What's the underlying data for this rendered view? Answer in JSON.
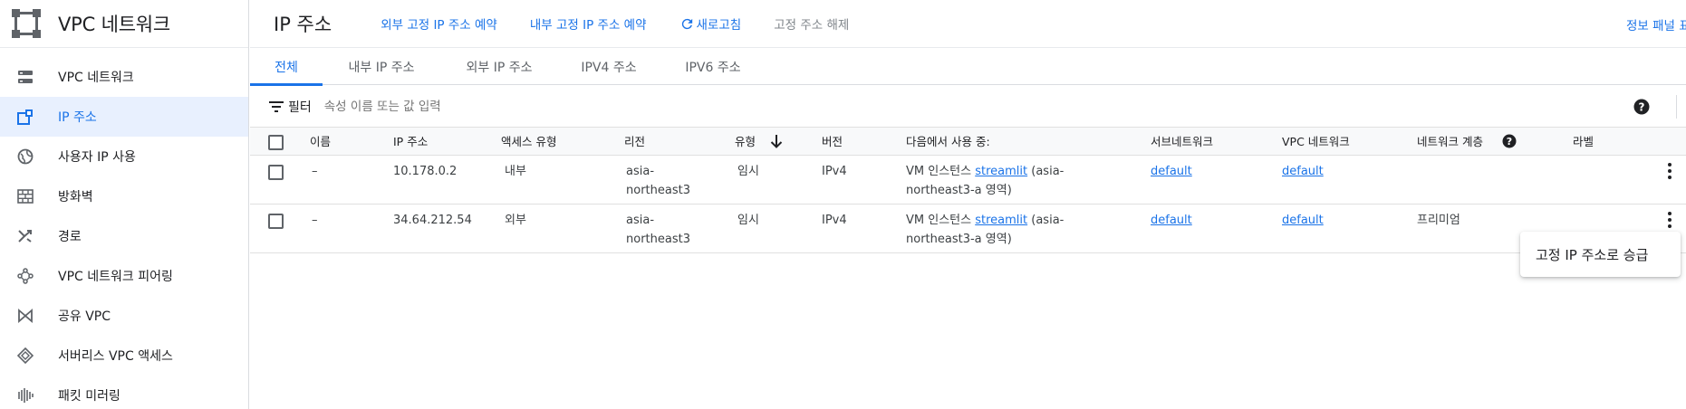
{
  "sidebar": {
    "title": "VPC 네트워크",
    "items": [
      {
        "label": "VPC 네트워크",
        "icon": "vpc-network-icon",
        "active": false
      },
      {
        "label": "IP 주소",
        "icon": "ip-address-icon",
        "active": true
      },
      {
        "label": "사용자 IP 사용",
        "icon": "globe-icon",
        "active": false
      },
      {
        "label": "방화벽",
        "icon": "firewall-icon",
        "active": false
      },
      {
        "label": "경로",
        "icon": "routes-icon",
        "active": false
      },
      {
        "label": "VPC 네트워크 피어링",
        "icon": "peering-icon",
        "active": false
      },
      {
        "label": "공유 VPC",
        "icon": "shared-vpc-icon",
        "active": false
      },
      {
        "label": "서버리스 VPC 액세스",
        "icon": "serverless-icon",
        "active": false
      },
      {
        "label": "패킷 미러링",
        "icon": "packet-mirroring-icon",
        "active": false
      }
    ]
  },
  "toolbar": {
    "page_title": "IP 주소",
    "reserve_external": "외부 고정 IP 주소 예약",
    "reserve_internal": "내부 고정 IP 주소 예약",
    "refresh": "새로고침",
    "release": "고정 주소 해제",
    "info_panel": "정보 패널 표시"
  },
  "tabs": [
    "전체",
    "내부 IP 주소",
    "외부 IP 주소",
    "IPV4 주소",
    "IPV6 주소"
  ],
  "filter": {
    "label": "필터",
    "placeholder": "속성 이름 또는 값 입력"
  },
  "table": {
    "columns": {
      "name": "이름",
      "ip": "IP 주소",
      "access": "액세스 유형",
      "region": "리전",
      "type": "유형",
      "version": "버전",
      "used_by": "다음에서 사용 중:",
      "subnet": "서브네트워크",
      "vpc": "VPC 네트워크",
      "tier": "네트워크 계층",
      "labels": "라벨"
    },
    "rows": [
      {
        "name": "–",
        "ip": "10.178.0.2",
        "access": "내부",
        "region_l1": "asia-",
        "region_l2": "northeast3",
        "type": "임시",
        "version": "IPv4",
        "used_prefix": "VM 인스턴스",
        "used_link": "streamlit",
        "used_suffix1": "(asia-",
        "used_suffix2": "northeast3-a 영역)",
        "subnet": "default",
        "vpc": "default",
        "tier": ""
      },
      {
        "name": "–",
        "ip": "34.64.212.54",
        "access": "외부",
        "region_l1": "asia-",
        "region_l2": "northeast3",
        "type": "임시",
        "version": "IPv4",
        "used_prefix": "VM 인스턴스",
        "used_link": "streamlit",
        "used_suffix1": "(asia-",
        "used_suffix2": "northeast3-a 영역)",
        "subnet": "default",
        "vpc": "default",
        "tier": "프리미엄"
      }
    ]
  },
  "popup": {
    "label": "고정 IP 주소로 승급"
  },
  "colors": {
    "accent": "#1a73e8",
    "active_bg": "#e8f0fe",
    "text": "#202124",
    "muted": "#5f6368"
  }
}
